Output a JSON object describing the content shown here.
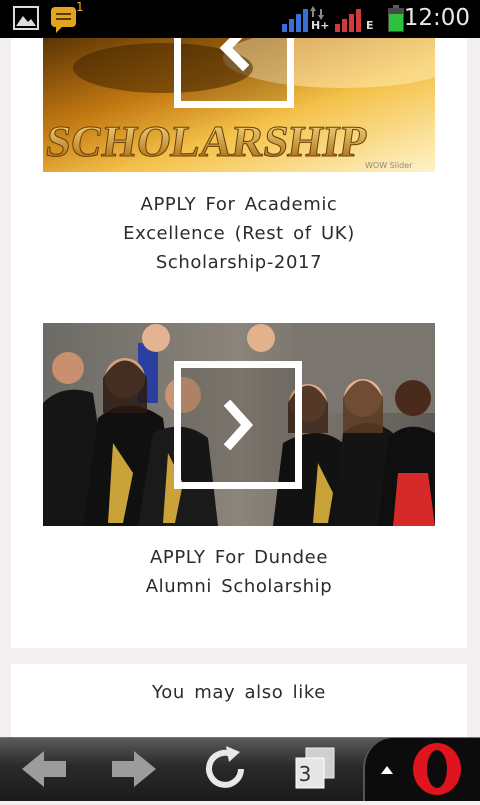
{
  "status_bar": {
    "time": "12:00",
    "message_count": "1",
    "network_type_1": "H+",
    "network_type_2": "E",
    "icons": [
      "gallery-icon",
      "message-icon",
      "signal-icon",
      "battery-icon"
    ]
  },
  "articles": [
    {
      "title": "APPLY For Academic Excellence (Rest of UK) Scholarship-2017",
      "image_caption": "SCHOLARSHIP",
      "image_watermark": "WOW Slider"
    },
    {
      "title": "APPLY For Dundee Alumni Scholarship"
    }
  ],
  "related": {
    "heading": "You may also like"
  },
  "browser_bar": {
    "tab_count": "3",
    "icons": [
      "back-arrow-icon",
      "forward-arrow-icon",
      "reload-icon",
      "tabs-icon",
      "menu-up-icon",
      "opera-logo-icon"
    ]
  },
  "colors": {
    "page_background": "#f3eef2",
    "card_background": "#ffffff",
    "status_bar": "#000000",
    "opera_red": "#e0141e"
  }
}
